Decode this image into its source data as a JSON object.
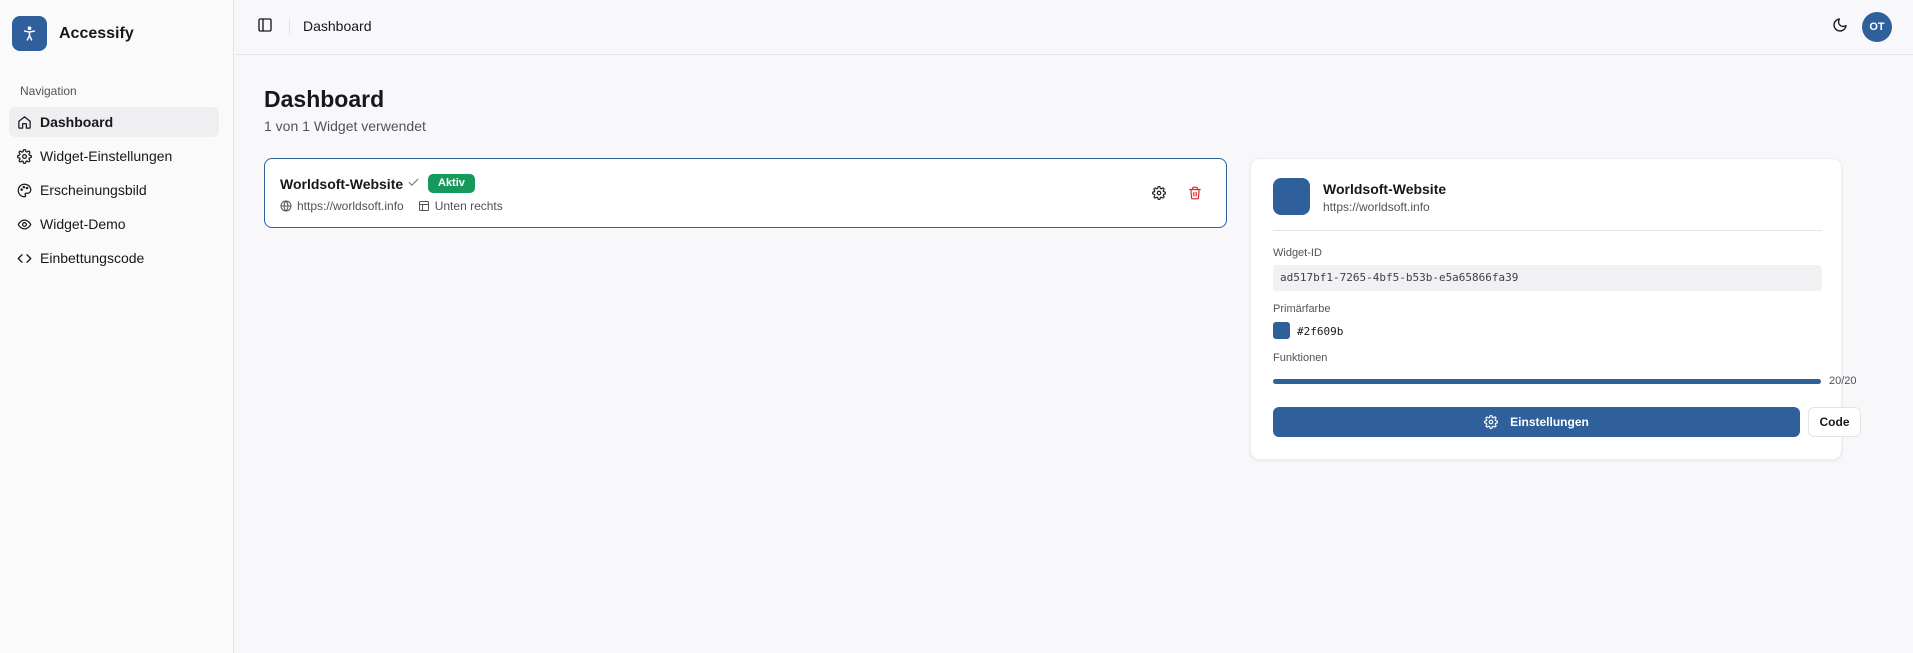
{
  "app": {
    "name": "Accessify"
  },
  "sidebar": {
    "heading": "Navigation",
    "items": [
      {
        "label": "Dashboard",
        "icon": "home-icon",
        "active": true
      },
      {
        "label": "Widget-Einstellungen",
        "icon": "gear-icon"
      },
      {
        "label": "Erscheinungsbild",
        "icon": "palette-icon"
      },
      {
        "label": "Widget-Demo",
        "icon": "eye-icon"
      },
      {
        "label": "Einbettungscode",
        "icon": "code-icon"
      }
    ]
  },
  "topbar": {
    "title": "Dashboard",
    "user_initials": "OT"
  },
  "main": {
    "title": "Dashboard",
    "subtitle": "1 von 1 Widget verwendet",
    "widget": {
      "name": "Worldsoft-Website",
      "status": "Aktiv",
      "url": "https://worldsoft.info",
      "position": "Unten rechts"
    }
  },
  "detail": {
    "name": "Worldsoft-Website",
    "url": "https://worldsoft.info",
    "widget_id_label": "Widget-ID",
    "widget_id": "ad517bf1-7265-4bf5-b53b-e5a65866fa39",
    "color_label": "Primärfarbe",
    "color_hex": "#2f609b",
    "features_label": "Funktionen",
    "features_count": "20/20",
    "features_fraction": 1.0,
    "settings_button": "Einstellungen",
    "code_button": "Code"
  },
  "colors": {
    "primary": "#2f609b",
    "success": "#169a5b",
    "danger": "#dc2626"
  }
}
